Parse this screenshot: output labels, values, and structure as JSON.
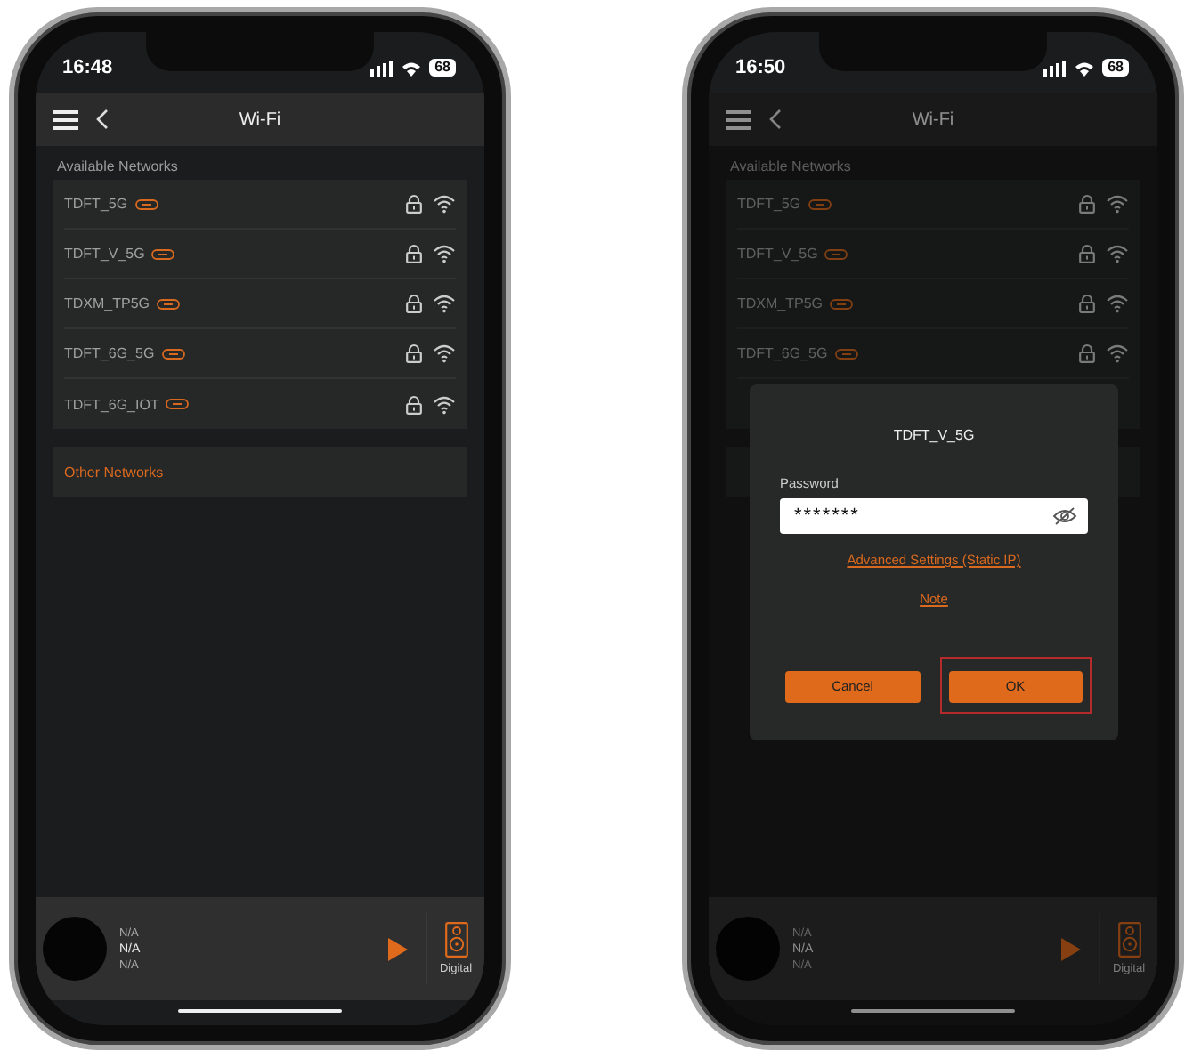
{
  "phones": [
    {
      "status_bar": {
        "time": "16:48",
        "battery": "68"
      },
      "nav": {
        "title": "Wi-Fi"
      },
      "section_label": "Available Networks",
      "networks": [
        {
          "name": "TDFT_5G"
        },
        {
          "name": "TDFT_V_5G"
        },
        {
          "name": "TDXM_TP5G"
        },
        {
          "name": "TDFT_6G_5G"
        },
        {
          "name": "TDFT_6G_IOT"
        }
      ],
      "other_networks": "Other Networks",
      "player": {
        "line_1": "N/A",
        "line_2": "N/A",
        "line_3": "N/A",
        "output_label": "Digital"
      },
      "dimmed": false
    },
    {
      "status_bar": {
        "time": "16:50",
        "battery": "68"
      },
      "nav": {
        "title": "Wi-Fi"
      },
      "section_label": "Available Networks",
      "networks": [
        {
          "name": "TDFT_5G"
        },
        {
          "name": "TDFT_V_5G"
        },
        {
          "name": "TDXM_TP5G"
        },
        {
          "name": "TDFT_6G_5G"
        }
      ],
      "player": {
        "line_1": "N/A",
        "line_2": "N/A",
        "line_3": "N/A",
        "output_label": "Digital"
      },
      "dimmed": true,
      "dialog": {
        "title": "TDFT_V_5G",
        "password_label": "Password",
        "password_value": "*******",
        "link": "Advanced Settings (Static IP)",
        "note": "Note",
        "buttons": [
          {
            "label": "Cancel",
            "highlighted": false
          },
          {
            "label": "OK",
            "highlighted": true
          }
        ]
      }
    }
  ]
}
